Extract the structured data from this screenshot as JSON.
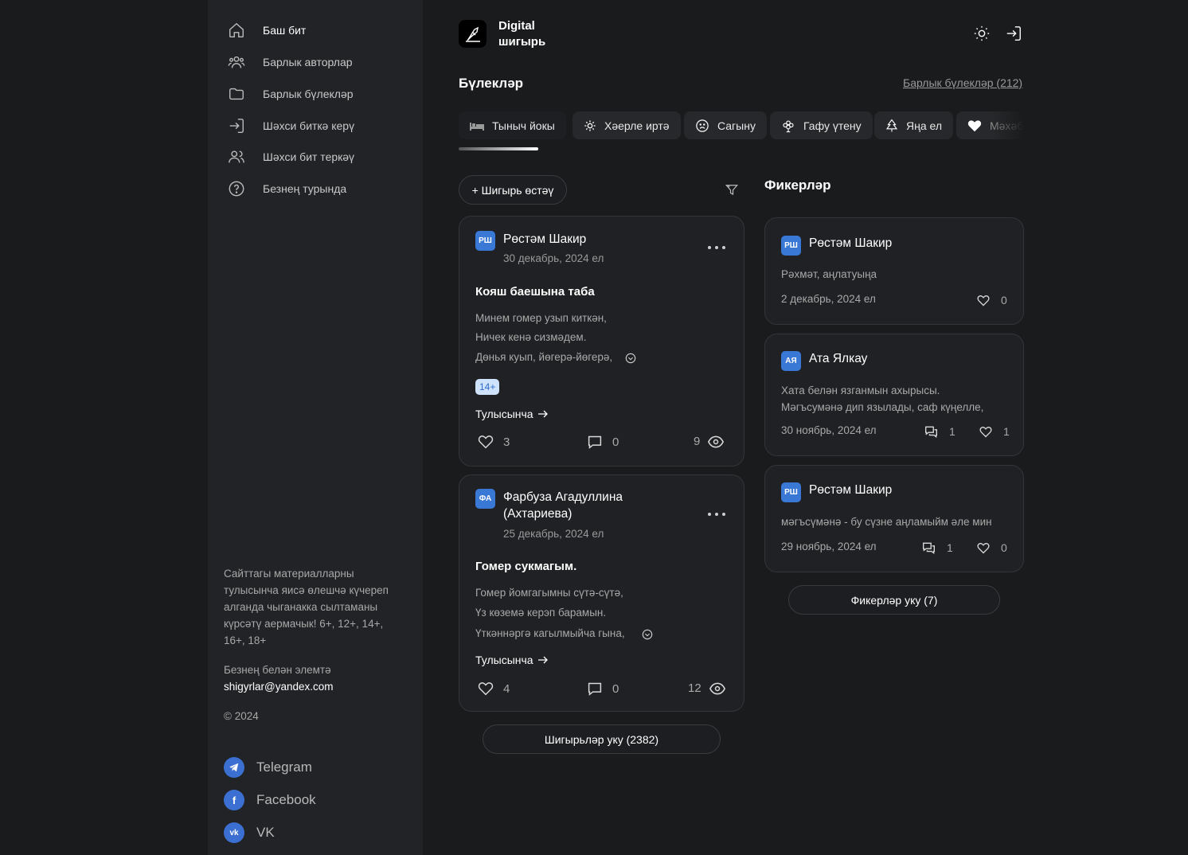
{
  "sidebar": {
    "nav": [
      {
        "label": "Баш бит",
        "icon": "home-icon"
      },
      {
        "label": "Барлык авторлар",
        "icon": "users-icon"
      },
      {
        "label": "Барлык бүлекләр",
        "icon": "folder-icon"
      },
      {
        "label": "Шәхси биткә керү",
        "icon": "login-icon"
      },
      {
        "label": "Шәхси бит теркәү",
        "icon": "register-icon"
      },
      {
        "label": "Безнең турында",
        "icon": "help-icon"
      }
    ],
    "note": "Сайттагы материалларны тулысынча яисә өлешчә күчереп алганда чыганакка сылтаманы күрсәтү аермачык! 6+, 12+, 14+, 16+, 18+",
    "contact_label": "Безнең белән элемтә",
    "contact_email": "shigyrlar@yandex.com",
    "copyright": "© 2024",
    "socials": [
      {
        "label": "Telegram",
        "icon": "telegram-icon"
      },
      {
        "label": "Facebook",
        "icon": "facebook-icon"
      },
      {
        "label": "VK",
        "icon": "vk-icon"
      }
    ]
  },
  "header": {
    "brand_line1": "Digital",
    "brand_line2": "шигырь"
  },
  "categories": {
    "title": "Бүлекләр",
    "all_link": "Барлык бүлекләр (212)",
    "chips": [
      {
        "label": "Тыныч йокы",
        "icon": "bed-icon"
      },
      {
        "label": "Хәерле иртә",
        "icon": "sun-icon"
      },
      {
        "label": "Сагыну",
        "icon": "sad-face-icon"
      },
      {
        "label": "Гафу үтену",
        "icon": "flower-icon"
      },
      {
        "label": "Яңа ел",
        "icon": "tree-icon"
      },
      {
        "label": "Мәхәббәт",
        "icon": "heart-icon"
      }
    ]
  },
  "feed": {
    "add_button": "+ Шигырь өстәү",
    "posts": [
      {
        "avatar": "РШ",
        "author": "Рөстәм Шакир",
        "date": "30 декабрь, 2024 ел",
        "title": "Кояш баешына таба",
        "lines": [
          "Минем гомер узып киткән,",
          "Ничек кенә сизмәдем.",
          "Дөнья куып, йөгерә-йөгерә,"
        ],
        "badge": "14+",
        "read_more": "Тулысынча",
        "likes": "3",
        "comments": "0",
        "views": "9"
      },
      {
        "avatar": "ФА",
        "author_line1": "Фарбуза Агадуллина",
        "author_line2": "(Ахтариева)",
        "date": "25 декабрь, 2024 ел",
        "title": "Гомер сукмагым.",
        "lines": [
          "Гомер йомгагымны сүтә-сүтә,",
          "Үз көземә керэп барамын.",
          "Үткәннәргә кагылмыйча гына,"
        ],
        "read_more": "Тулысынча",
        "likes": "4",
        "comments": "0",
        "views": "12"
      }
    ],
    "more_button": "Шигырьләр уку (2382)"
  },
  "comments": {
    "title": "Фикерләр",
    "items": [
      {
        "avatar": "РШ",
        "author": "Рөстәм Шакир",
        "text_lines": [
          "Рәхмәт, аңлатуыңа"
        ],
        "date": "2 декабрь, 2024 ел",
        "likes": "0"
      },
      {
        "avatar": "АЯ",
        "author": "Ата Ялкау",
        "text_lines": [
          "Хата белән язганмын ахырысы.",
          "Мәгъсумәнә дип язылады, саф күңелле,"
        ],
        "date": "30 ноябрь, 2024 ел",
        "replies": "1",
        "likes": "1"
      },
      {
        "avatar": "РШ",
        "author": "Рөстәм Шакир",
        "text_lines": [
          "мәгъсүмәнә - бу сүзне аңламыйм әле мин"
        ],
        "date": "29 ноябрь, 2024 ел",
        "replies": "1",
        "likes": "0"
      }
    ],
    "more_button": "Фикерләр уку (7)"
  }
}
